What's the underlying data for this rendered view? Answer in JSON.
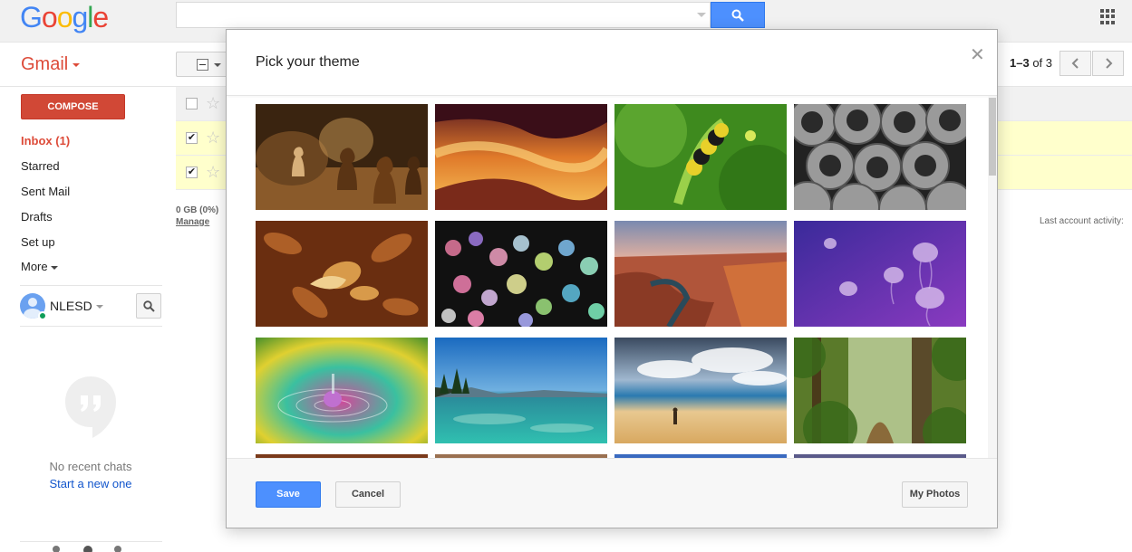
{
  "header": {
    "logo_letters": [
      {
        "ch": "G",
        "color": "#4285f4"
      },
      {
        "ch": "o",
        "color": "#ea4335"
      },
      {
        "ch": "o",
        "color": "#fbbc05"
      },
      {
        "ch": "g",
        "color": "#4285f4"
      },
      {
        "ch": "l",
        "color": "#34a853"
      },
      {
        "ch": "e",
        "color": "#ea4335"
      }
    ],
    "search_value": "",
    "search_icon": "search-icon",
    "apps_icon": "apps-grid-icon"
  },
  "subheader": {
    "gmail_label": "Gmail",
    "pager_range": "1–3",
    "pager_of": "of 3",
    "prev_icon": "chevron-left-icon",
    "next_icon": "chevron-right-icon"
  },
  "sidebar": {
    "compose_label": "COMPOSE",
    "items": [
      {
        "label": "Inbox (1)",
        "active": true
      },
      {
        "label": "Starred",
        "active": false
      },
      {
        "label": "Sent Mail",
        "active": false
      },
      {
        "label": "Drafts",
        "active": false
      },
      {
        "label": "Set up",
        "active": false
      }
    ],
    "more_label": "More",
    "account_name": "NLESD",
    "no_chats": "No recent chats",
    "start_new": "Start a new one"
  },
  "mail": {
    "rows": [
      {
        "checked": false
      },
      {
        "checked": true
      },
      {
        "checked": true
      }
    ],
    "storage": "0 GB (0%)",
    "manage": "Manage",
    "last_activity": "Last account activity:"
  },
  "modal": {
    "title": "Pick your theme",
    "close_icon": "close-icon",
    "themes": [
      {
        "name": "chess"
      },
      {
        "name": "canyon-swirl"
      },
      {
        "name": "caterpillar"
      },
      {
        "name": "pipes"
      },
      {
        "name": "autumn-leaves"
      },
      {
        "name": "bokeh-lights"
      },
      {
        "name": "grand-canyon-river"
      },
      {
        "name": "jellyfish"
      },
      {
        "name": "water-drop"
      },
      {
        "name": "lake-tahoe"
      },
      {
        "name": "beach"
      },
      {
        "name": "forest"
      },
      {
        "name": "row4-1"
      },
      {
        "name": "row4-2"
      },
      {
        "name": "row4-3"
      },
      {
        "name": "row4-4"
      }
    ],
    "save_label": "Save",
    "cancel_label": "Cancel",
    "my_photos_label": "My Photos"
  }
}
